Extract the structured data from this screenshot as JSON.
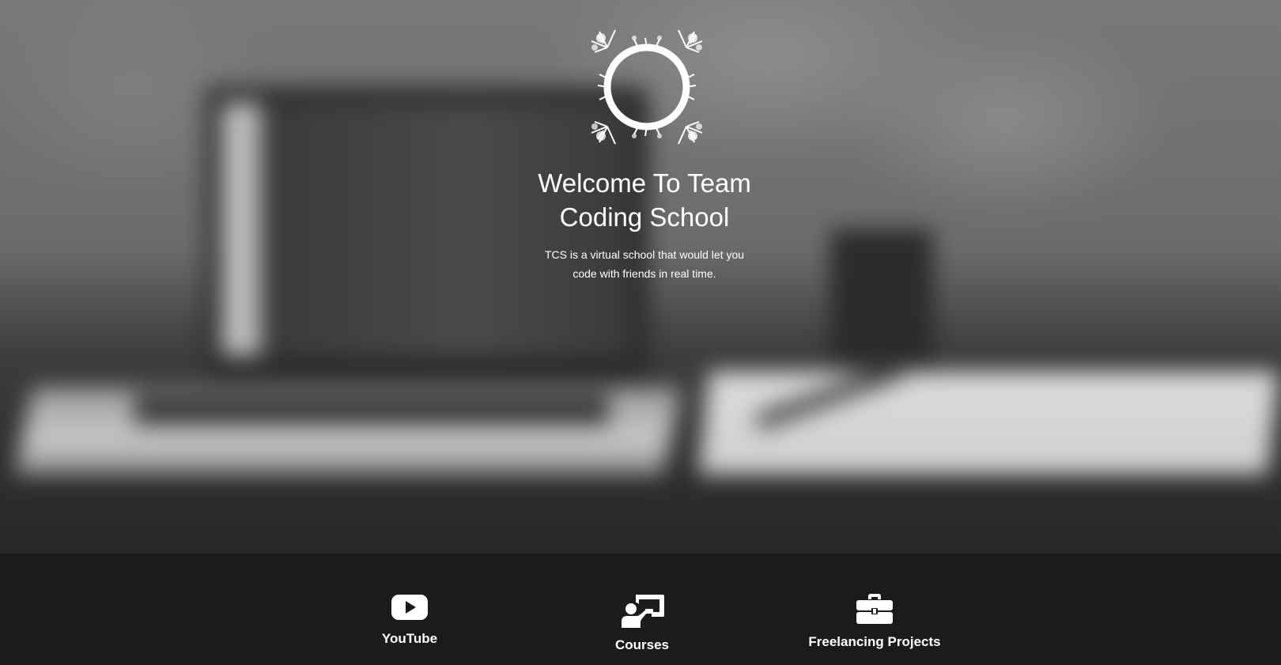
{
  "hero": {
    "title": "Welcome To Team Coding School",
    "tagline": "TCS is a virtual school that would let you code with friends in real time.",
    "logo_icon": "tree-ring-logo-icon"
  },
  "services": [
    {
      "label": "YouTube",
      "icon": "youtube-icon"
    },
    {
      "label": "Courses",
      "icon": "chalkboard-teacher-icon"
    },
    {
      "label": "Freelancing Projects",
      "icon": "briefcase-icon"
    }
  ],
  "colors": {
    "text": "#ffffff",
    "footer_bg": "#1b1b1b"
  }
}
